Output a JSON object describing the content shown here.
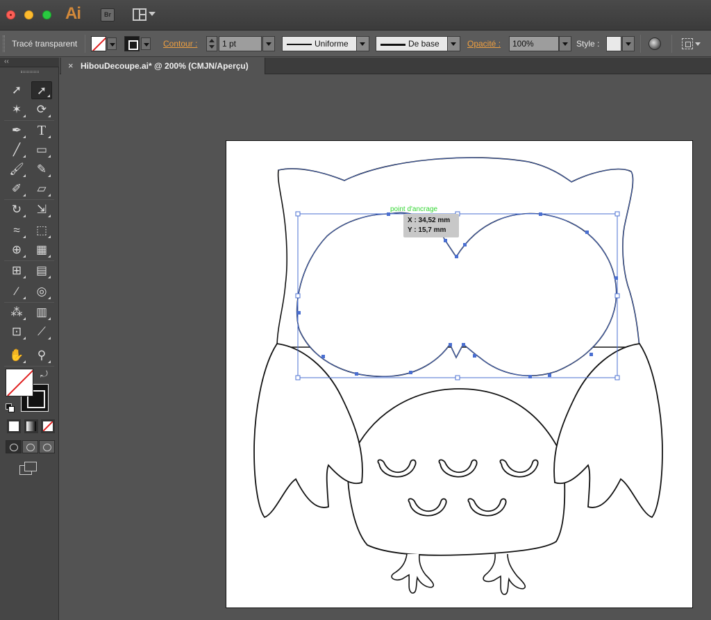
{
  "window": {
    "app_logo": "Ai",
    "bridge_label": "Br"
  },
  "control_bar": {
    "selection_label": "Tracé transparent",
    "contour_label": "Contour :",
    "stroke_weight": "1 pt",
    "variable_width_profile": "Uniforme",
    "brush_definition": "De base",
    "opacity_label": "Opacité :",
    "opacity_value": "100%",
    "style_label": "Style :"
  },
  "document": {
    "tab_close": "×",
    "tab_title": "HibouDecoupe.ai* @ 200% (CMJN/Aperçu)"
  },
  "tools_panel": {
    "collapse_label": "‹‹",
    "swap_glyph": "⤾"
  },
  "canvas": {
    "smart_guide_label": "point d'ancrage",
    "tooltip_x": "X : 34,52 mm",
    "tooltip_y": "Y : 15,7 mm"
  },
  "colors": {
    "app_bg": "#535353",
    "accent_orange": "#f0a040",
    "selection_blue": "#4a6fd1",
    "smart_guide_green": "#33d633"
  },
  "icons": {
    "tools": [
      "selection-tool-icon",
      "direct-selection-tool-icon",
      "magic-wand-icon",
      "lasso-icon",
      "pen-tool-icon",
      "type-tool-icon",
      "line-tool-icon",
      "rectangle-tool-icon",
      "paintbrush-icon",
      "pencil-icon",
      "blob-brush-icon",
      "eraser-icon",
      "rotate-tool-icon",
      "scale-tool-icon",
      "warp-tool-icon",
      "free-transform-icon",
      "shape-builder-icon",
      "perspective-grid-icon",
      "mesh-tool-icon",
      "gradient-tool-icon",
      "eyedropper-icon",
      "blend-tool-icon",
      "symbol-sprayer-icon",
      "column-graph-icon",
      "artboard-tool-icon",
      "slice-tool-icon",
      "hand-tool-icon",
      "zoom-tool-icon"
    ]
  }
}
